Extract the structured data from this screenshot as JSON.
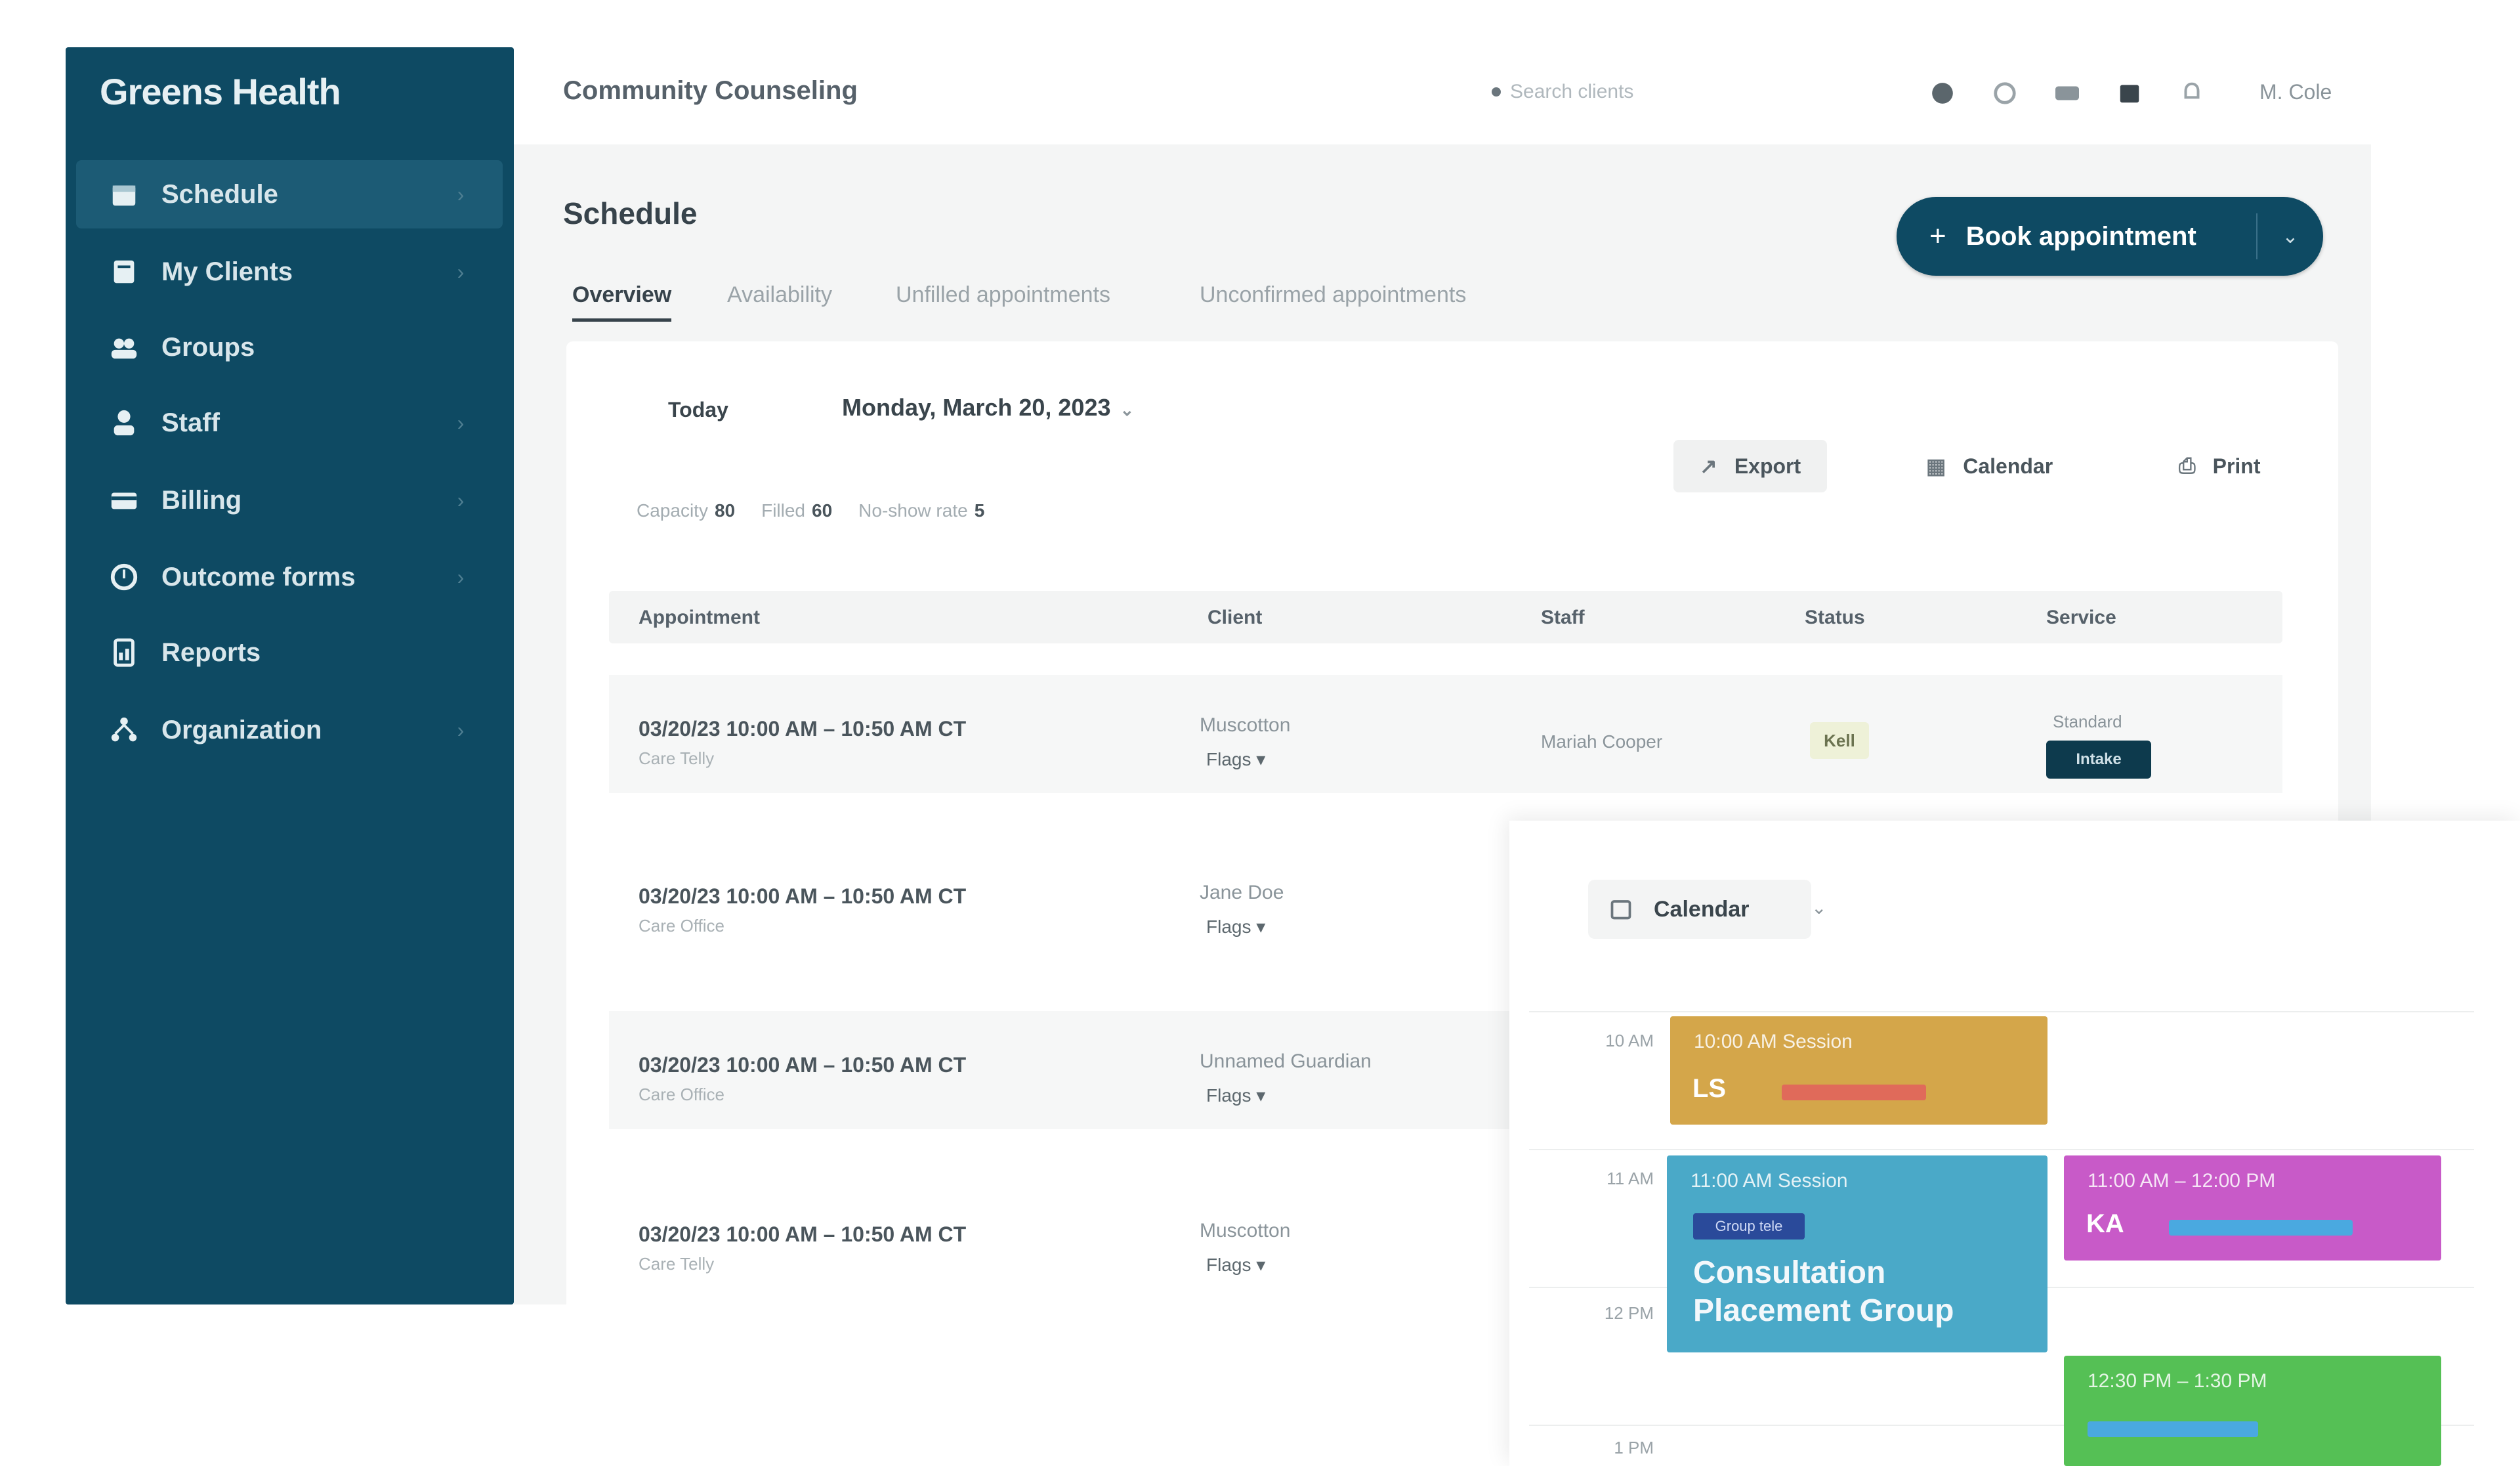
{
  "app": {
    "brand": "Greens Health",
    "org_title": "Community Counseling"
  },
  "sidebar": {
    "items": [
      {
        "label": "Schedule",
        "icon": "calendar-icon",
        "active": true
      },
      {
        "label": "My Clients",
        "icon": "clients-icon"
      },
      {
        "label": "Groups",
        "icon": "groups-icon"
      },
      {
        "label": "Staff",
        "icon": "staff-icon"
      },
      {
        "label": "Billing",
        "icon": "billing-icon"
      },
      {
        "label": "Outcome forms",
        "icon": "forms-icon"
      },
      {
        "label": "Reports",
        "icon": "reports-icon"
      },
      {
        "label": "Organization",
        "icon": "organization-icon"
      }
    ]
  },
  "topbar": {
    "search_placeholder": "Search clients",
    "user_name": "M. Cole"
  },
  "page": {
    "title": "Schedule",
    "book_button": "Book appointment",
    "tabs": [
      "Overview",
      "Availability",
      "Unfilled appointments",
      "Unconfirmed appointments"
    ]
  },
  "filters": {
    "date_label": "Today",
    "date_value": "Monday, March 20, 2023",
    "export_label": "Export",
    "calendar_label": "Calendar",
    "print_label": "Print"
  },
  "stats": [
    {
      "label": "Capacity",
      "value": "80"
    },
    {
      "label": "Filled",
      "value": "60"
    },
    {
      "label": "No-show rate",
      "value": "5"
    }
  ],
  "table": {
    "headers": [
      "Appointment",
      "Client",
      "Staff",
      "Status",
      "Service"
    ],
    "rows": [
      {
        "time": "03/20/23 10:00 AM – 10:50 AM CT",
        "sub": "Care Telly",
        "client": "Muscotton",
        "tag": "Flags",
        "staff": "Mariah Cooper",
        "status": "Kell",
        "service_note": "Standard",
        "service_badge": "Intake"
      },
      {
        "time": "03/20/23 10:00 AM – 10:50 AM CT",
        "sub": "Care Office",
        "client": "Jane Doe",
        "tag": "Flags"
      },
      {
        "time": "03/20/23 10:00 AM – 10:50 AM CT",
        "sub": "Care Office",
        "client": "Unnamed Guardian",
        "tag": "Flags"
      },
      {
        "time": "03/20/23 10:00 AM – 10:50 AM CT",
        "sub": "Care Telly",
        "client": "Muscotton",
        "tag": "Flags"
      }
    ]
  },
  "calendar": {
    "toggle_label": "Calendar",
    "hours": [
      "10 AM",
      "11 AM",
      "12 PM",
      "1 PM"
    ],
    "events": [
      {
        "title": "10:00 AM Session",
        "initials": "LS",
        "color": "#d4a64a",
        "bar_color": "#e06a5a"
      },
      {
        "title": "11:00 AM Session",
        "pill": "Group tele",
        "headline": "Consultation Placement Group",
        "color": "#4aa9c8"
      },
      {
        "title": "11:00 AM – 12:00 PM",
        "initials": "KA",
        "color": "#c85ac8",
        "bar_color": "#4aa9e0"
      },
      {
        "title": "12:30 PM – 1:30 PM",
        "color": "#55c055",
        "bar_color": "#4aa9e0"
      }
    ]
  },
  "colors": {
    "sidebar": "#0e4a63",
    "accent": "#0e4a63"
  }
}
